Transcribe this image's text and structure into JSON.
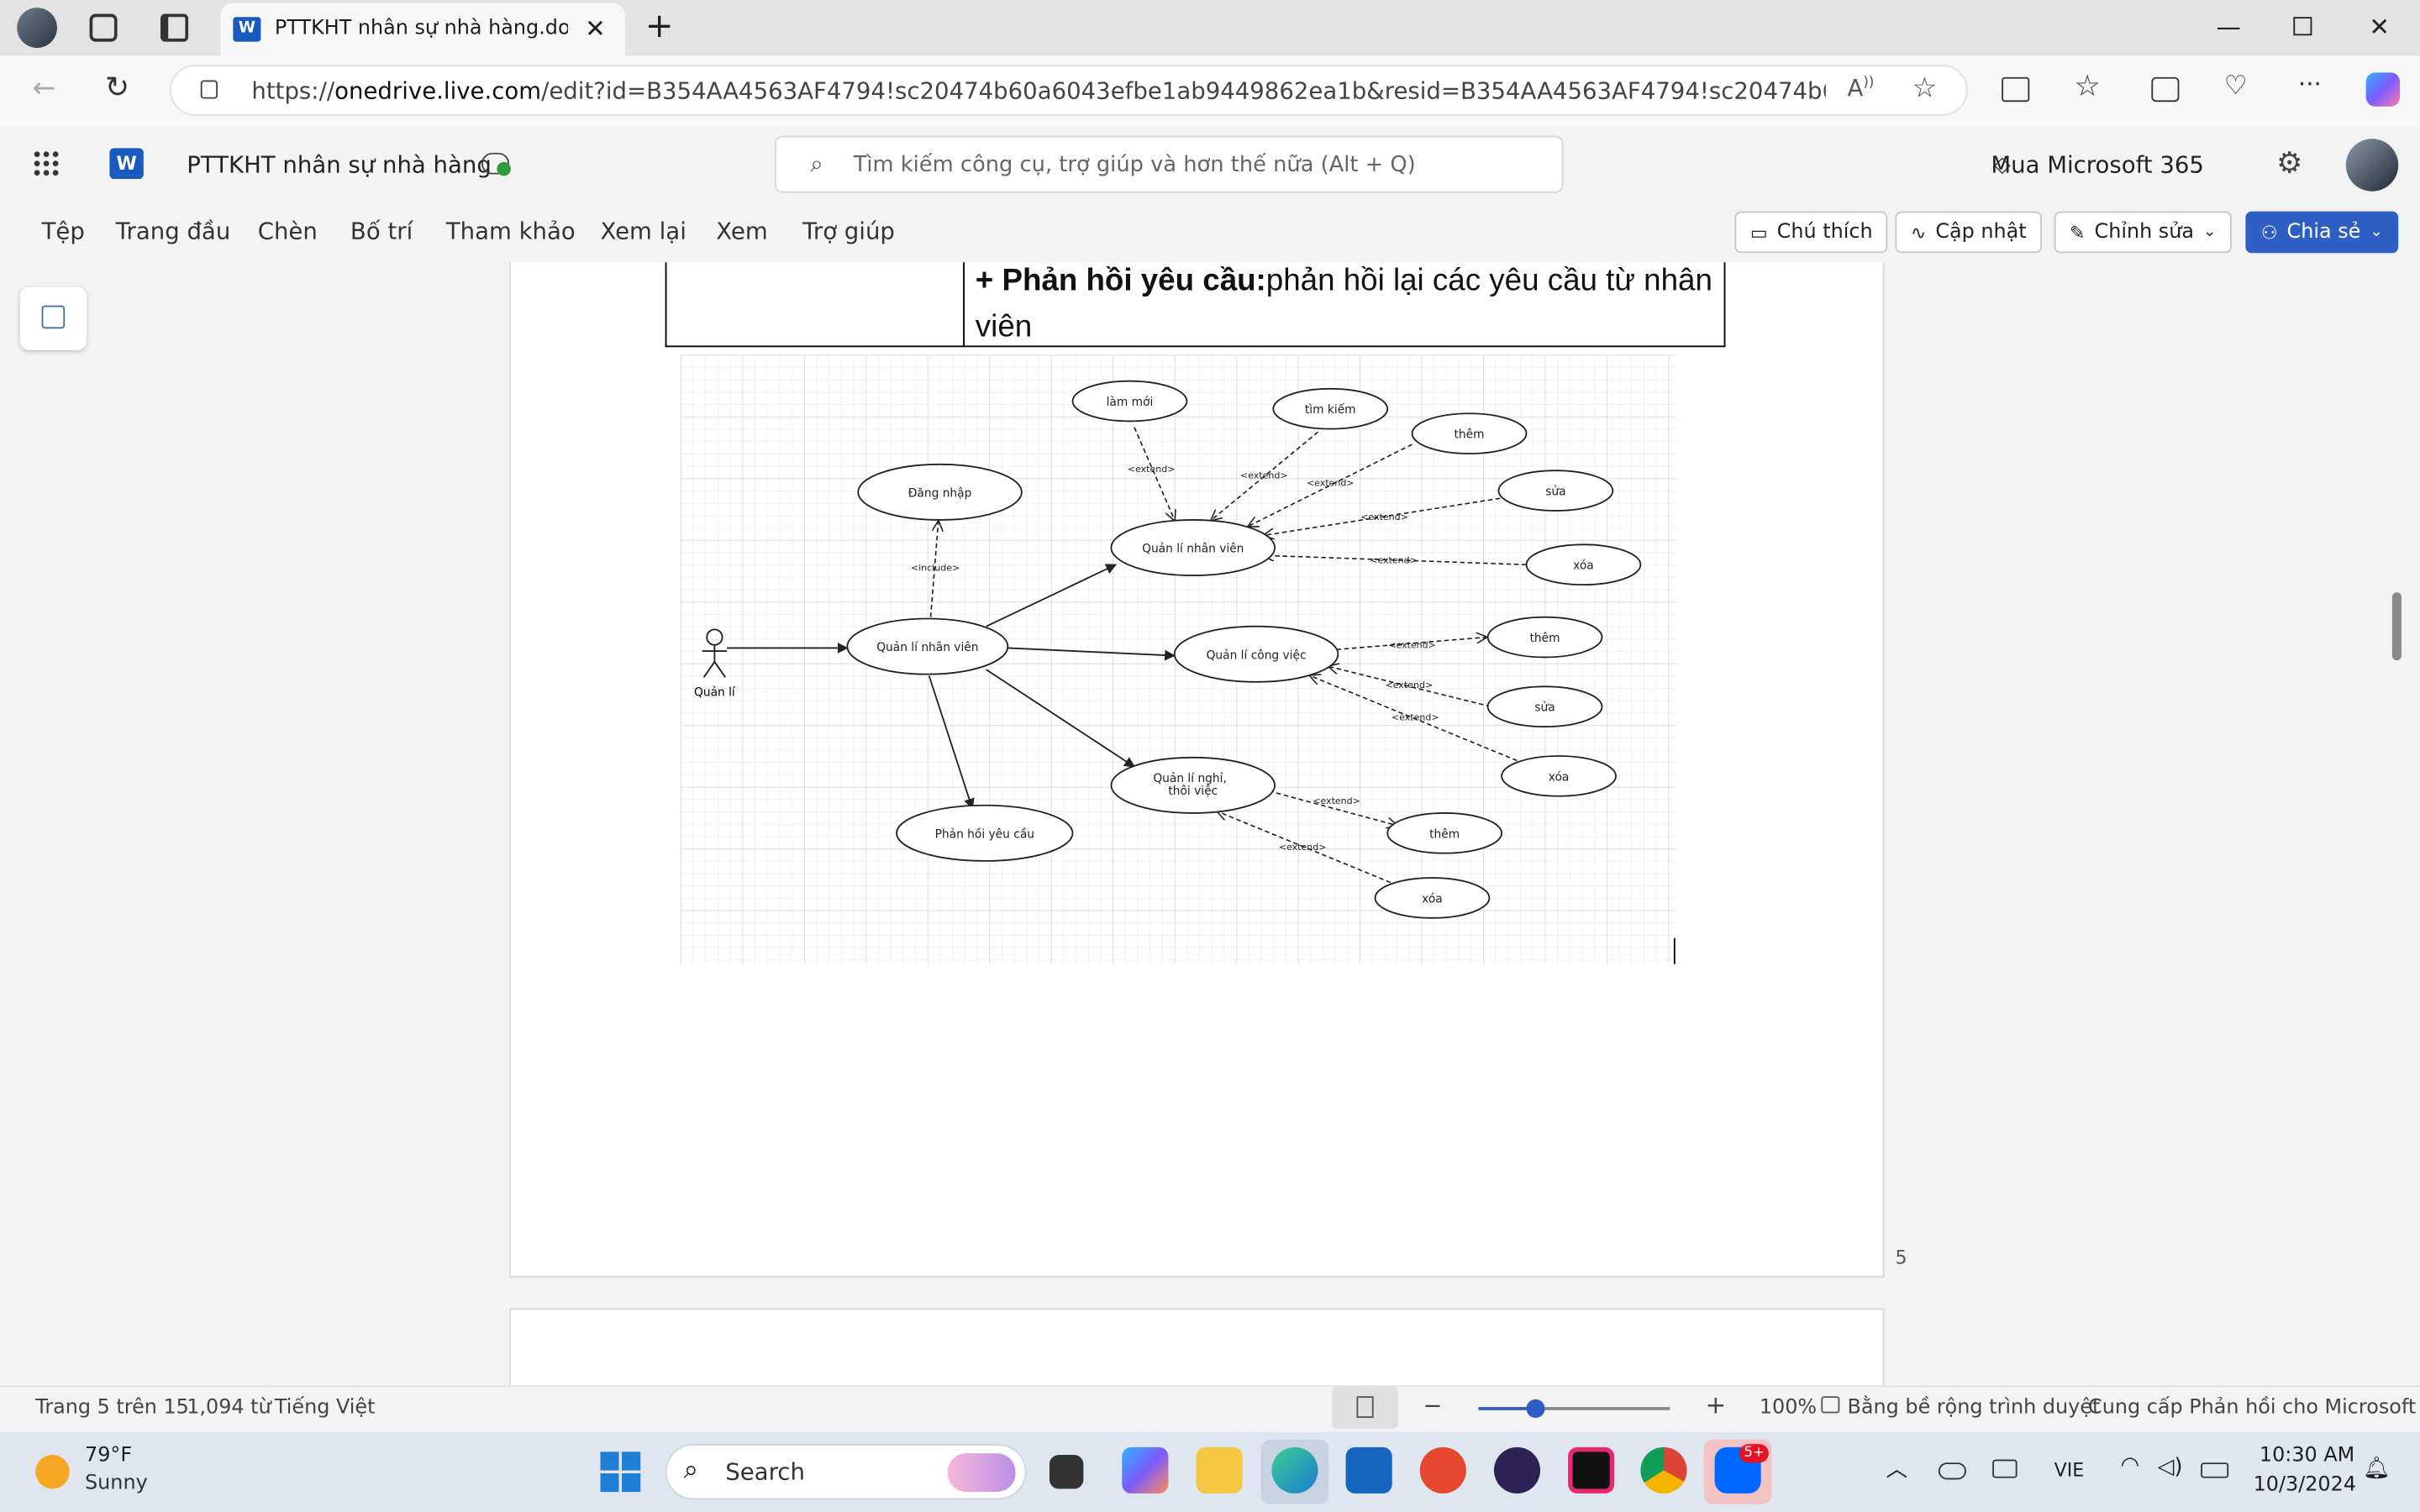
{
  "browser": {
    "tab_title": "PTTKHT nhân sự nhà hàng.docx -",
    "url_prefix": "https://",
    "url_host": "onedrive.live.com",
    "url_rest": "/edit?id=B354AA4563AF4794!sc20474b60a6043efbe1ab9449862ea1b&resid=B354AA4563AF4794!sc20474b60a6043efbe1a..."
  },
  "word": {
    "doc_title": "PTTKHT nhân sự nhà hàng",
    "search_placeholder": "Tìm kiếm công cụ, trợ giúp và hơn thế nữa (Alt + Q)",
    "buy_label": "Mua Microsoft 365"
  },
  "ribbon": {
    "tabs": [
      "Tệp",
      "Trang đầu",
      "Chèn",
      "Bố trí",
      "Tham khảo",
      "Xem lại",
      "Xem",
      "Trợ giúp"
    ],
    "comments": "Chú thích",
    "catchup": "Cập nhật",
    "editing": "Chỉnh sửa",
    "share": "Chia sẻ"
  },
  "document": {
    "cell_bold": "+ Phản hồi yêu cầu:",
    "cell_text": "phản hồi lại các yêu cầu từ nhân viên",
    "page_number": "5"
  },
  "diagram": {
    "actor": "Quản lí",
    "main": "Quản lí nhân viên",
    "login": "Đăng nhập",
    "include": "<include>",
    "extend": "<extend>",
    "qlnv": "Quản lí nhân viên",
    "qlcv": "Quản lí công việc",
    "qlnghi_1": "Quản lí nghỉ,",
    "qlnghi_2": "thôi việc",
    "phanhoi": "Phản hồi yêu cầu",
    "lammoi": "làm mới",
    "timkiem": "tìm kiếm",
    "them": "thêm",
    "sua": "sửa",
    "xoa": "xóa"
  },
  "status": {
    "page": "Trang 5 trên 15",
    "words": "1,094 từ",
    "language": "Tiếng Việt",
    "zoom": "100%",
    "zoom_level": 0.3,
    "width_mode": "Bằng bề rộng trình duyệt",
    "feedback": "Cung cấp Phản hồi cho Microsoft"
  },
  "taskbar": {
    "temp": "79°F",
    "weather": "Sunny",
    "search": "Search",
    "lang": "VIE",
    "time": "10:30 AM",
    "date": "10/3/2024",
    "zalo_badge": "5+"
  },
  "colors": {
    "share_blue": "#2f5fc4",
    "word_blue": "#185abd"
  }
}
